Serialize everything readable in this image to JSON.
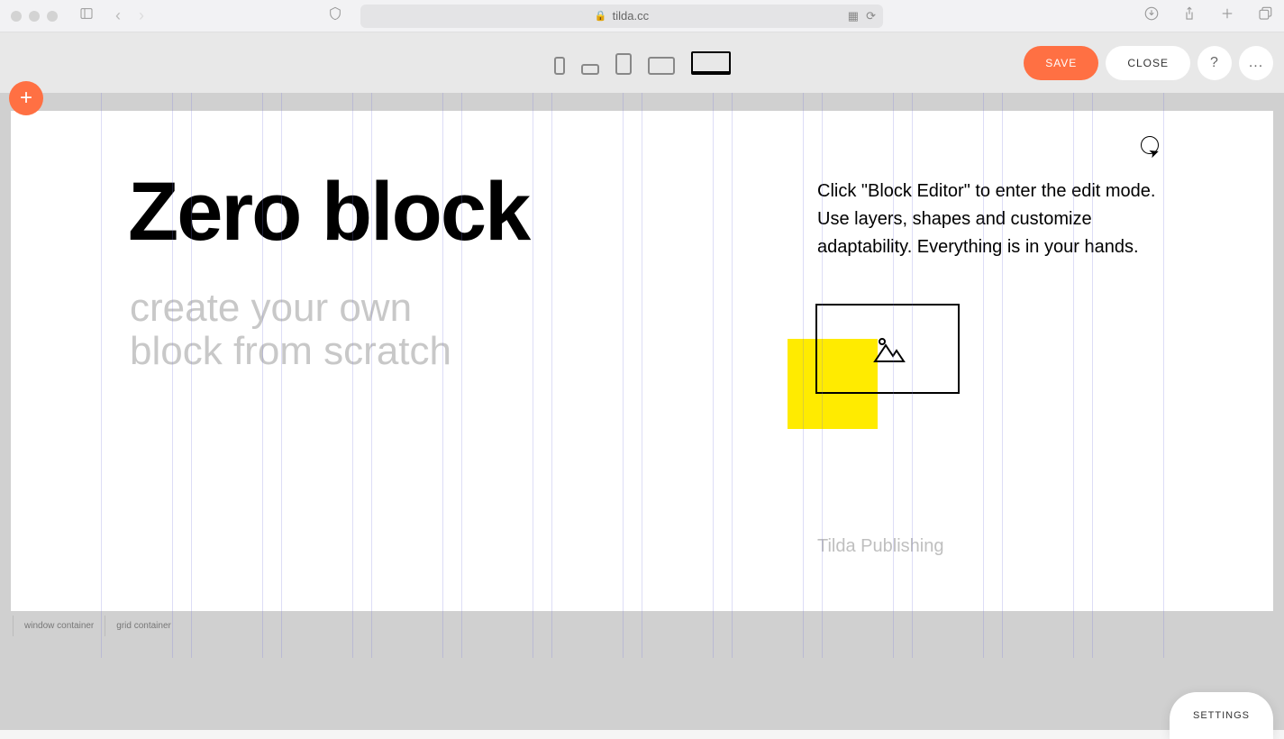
{
  "browser": {
    "url_domain": "tilda.cc"
  },
  "toolbar": {
    "save_label": "SAVE",
    "close_label": "CLOSE",
    "help_label": "?",
    "more_label": "..."
  },
  "canvas": {
    "heading": "Zero block",
    "subhead": "create your own\nblock from scratch",
    "description": "Click \"Block Editor\" to enter the edit mode. Use layers, shapes and customize adaptability. Everything is in your hands.",
    "caption": "Tilda Publishing"
  },
  "container_labels": {
    "window": "window container",
    "grid": "grid container"
  },
  "settings_label": "SETTINGS",
  "colors": {
    "accent": "#ff7043",
    "yellow": "#ffeb00"
  }
}
